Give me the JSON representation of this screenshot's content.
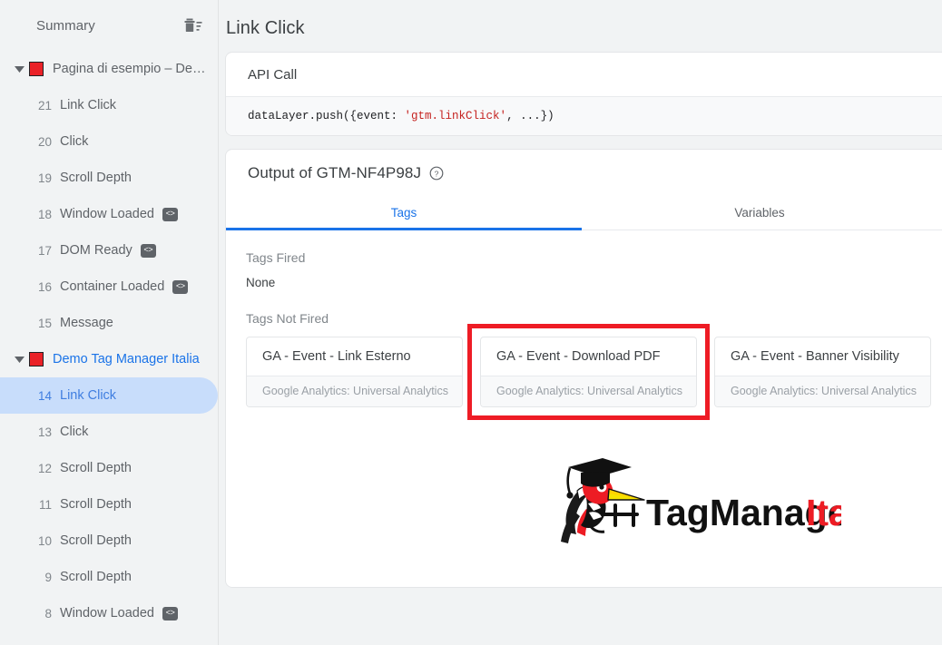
{
  "sidebar": {
    "title": "Summary",
    "trash_icon": "delete-icon",
    "groups": [
      {
        "label": "Pagina di esempio – De…",
        "color": "#ea2127",
        "active": false,
        "events": [
          {
            "num": "21",
            "name": "Link Click",
            "badge": ""
          },
          {
            "num": "20",
            "name": "Click",
            "badge": ""
          },
          {
            "num": "19",
            "name": "Scroll Depth",
            "badge": ""
          },
          {
            "num": "18",
            "name": "Window Loaded",
            "badge": "<>"
          },
          {
            "num": "17",
            "name": "DOM Ready",
            "badge": "<>"
          },
          {
            "num": "16",
            "name": "Container Loaded",
            "badge": "<>"
          },
          {
            "num": "15",
            "name": "Message",
            "badge": ""
          }
        ]
      },
      {
        "label": "Demo Tag Manager Italia",
        "color": "#ea2127",
        "active": true,
        "events": [
          {
            "num": "14",
            "name": "Link Click",
            "badge": "",
            "selected": true
          },
          {
            "num": "13",
            "name": "Click",
            "badge": ""
          },
          {
            "num": "12",
            "name": "Scroll Depth",
            "badge": ""
          },
          {
            "num": "11",
            "name": "Scroll Depth",
            "badge": ""
          },
          {
            "num": "10",
            "name": "Scroll Depth",
            "badge": ""
          },
          {
            "num": "9",
            "name": "Scroll Depth",
            "badge": ""
          },
          {
            "num": "8",
            "name": "Window Loaded",
            "badge": "<>"
          }
        ]
      }
    ]
  },
  "main": {
    "page_title": "Link Click",
    "api_call": {
      "heading": "API Call",
      "code_prefix": "dataLayer.push({event: ",
      "code_string": "'gtm.linkClick'",
      "code_suffix": ", ...})"
    },
    "output": {
      "heading": "Output of GTM-NF4P98J",
      "help_icon": "help-circle-icon",
      "tabs": [
        {
          "label": "Tags",
          "active": true
        },
        {
          "label": "Variables",
          "active": false
        }
      ],
      "tags_fired_label": "Tags Fired",
      "tags_fired_value": "None",
      "tags_not_fired_label": "Tags Not Fired",
      "tags_not_fired": [
        {
          "name": "GA - Event - Link Esterno",
          "type": "Google Analytics: Universal Analytics",
          "highlighted": false
        },
        {
          "name": "GA - Event - Download PDF",
          "type": "Google Analytics: Universal Analytics",
          "highlighted": true
        },
        {
          "name": "GA - Event - Banner Visibility",
          "type": "Google Analytics: Universal Analytics",
          "highlighted": false
        }
      ],
      "highlight_color": "#ee1c25"
    },
    "logo": {
      "name_black": "TagManager",
      "name_red": "Italia",
      "red": "#ed1c24"
    }
  }
}
